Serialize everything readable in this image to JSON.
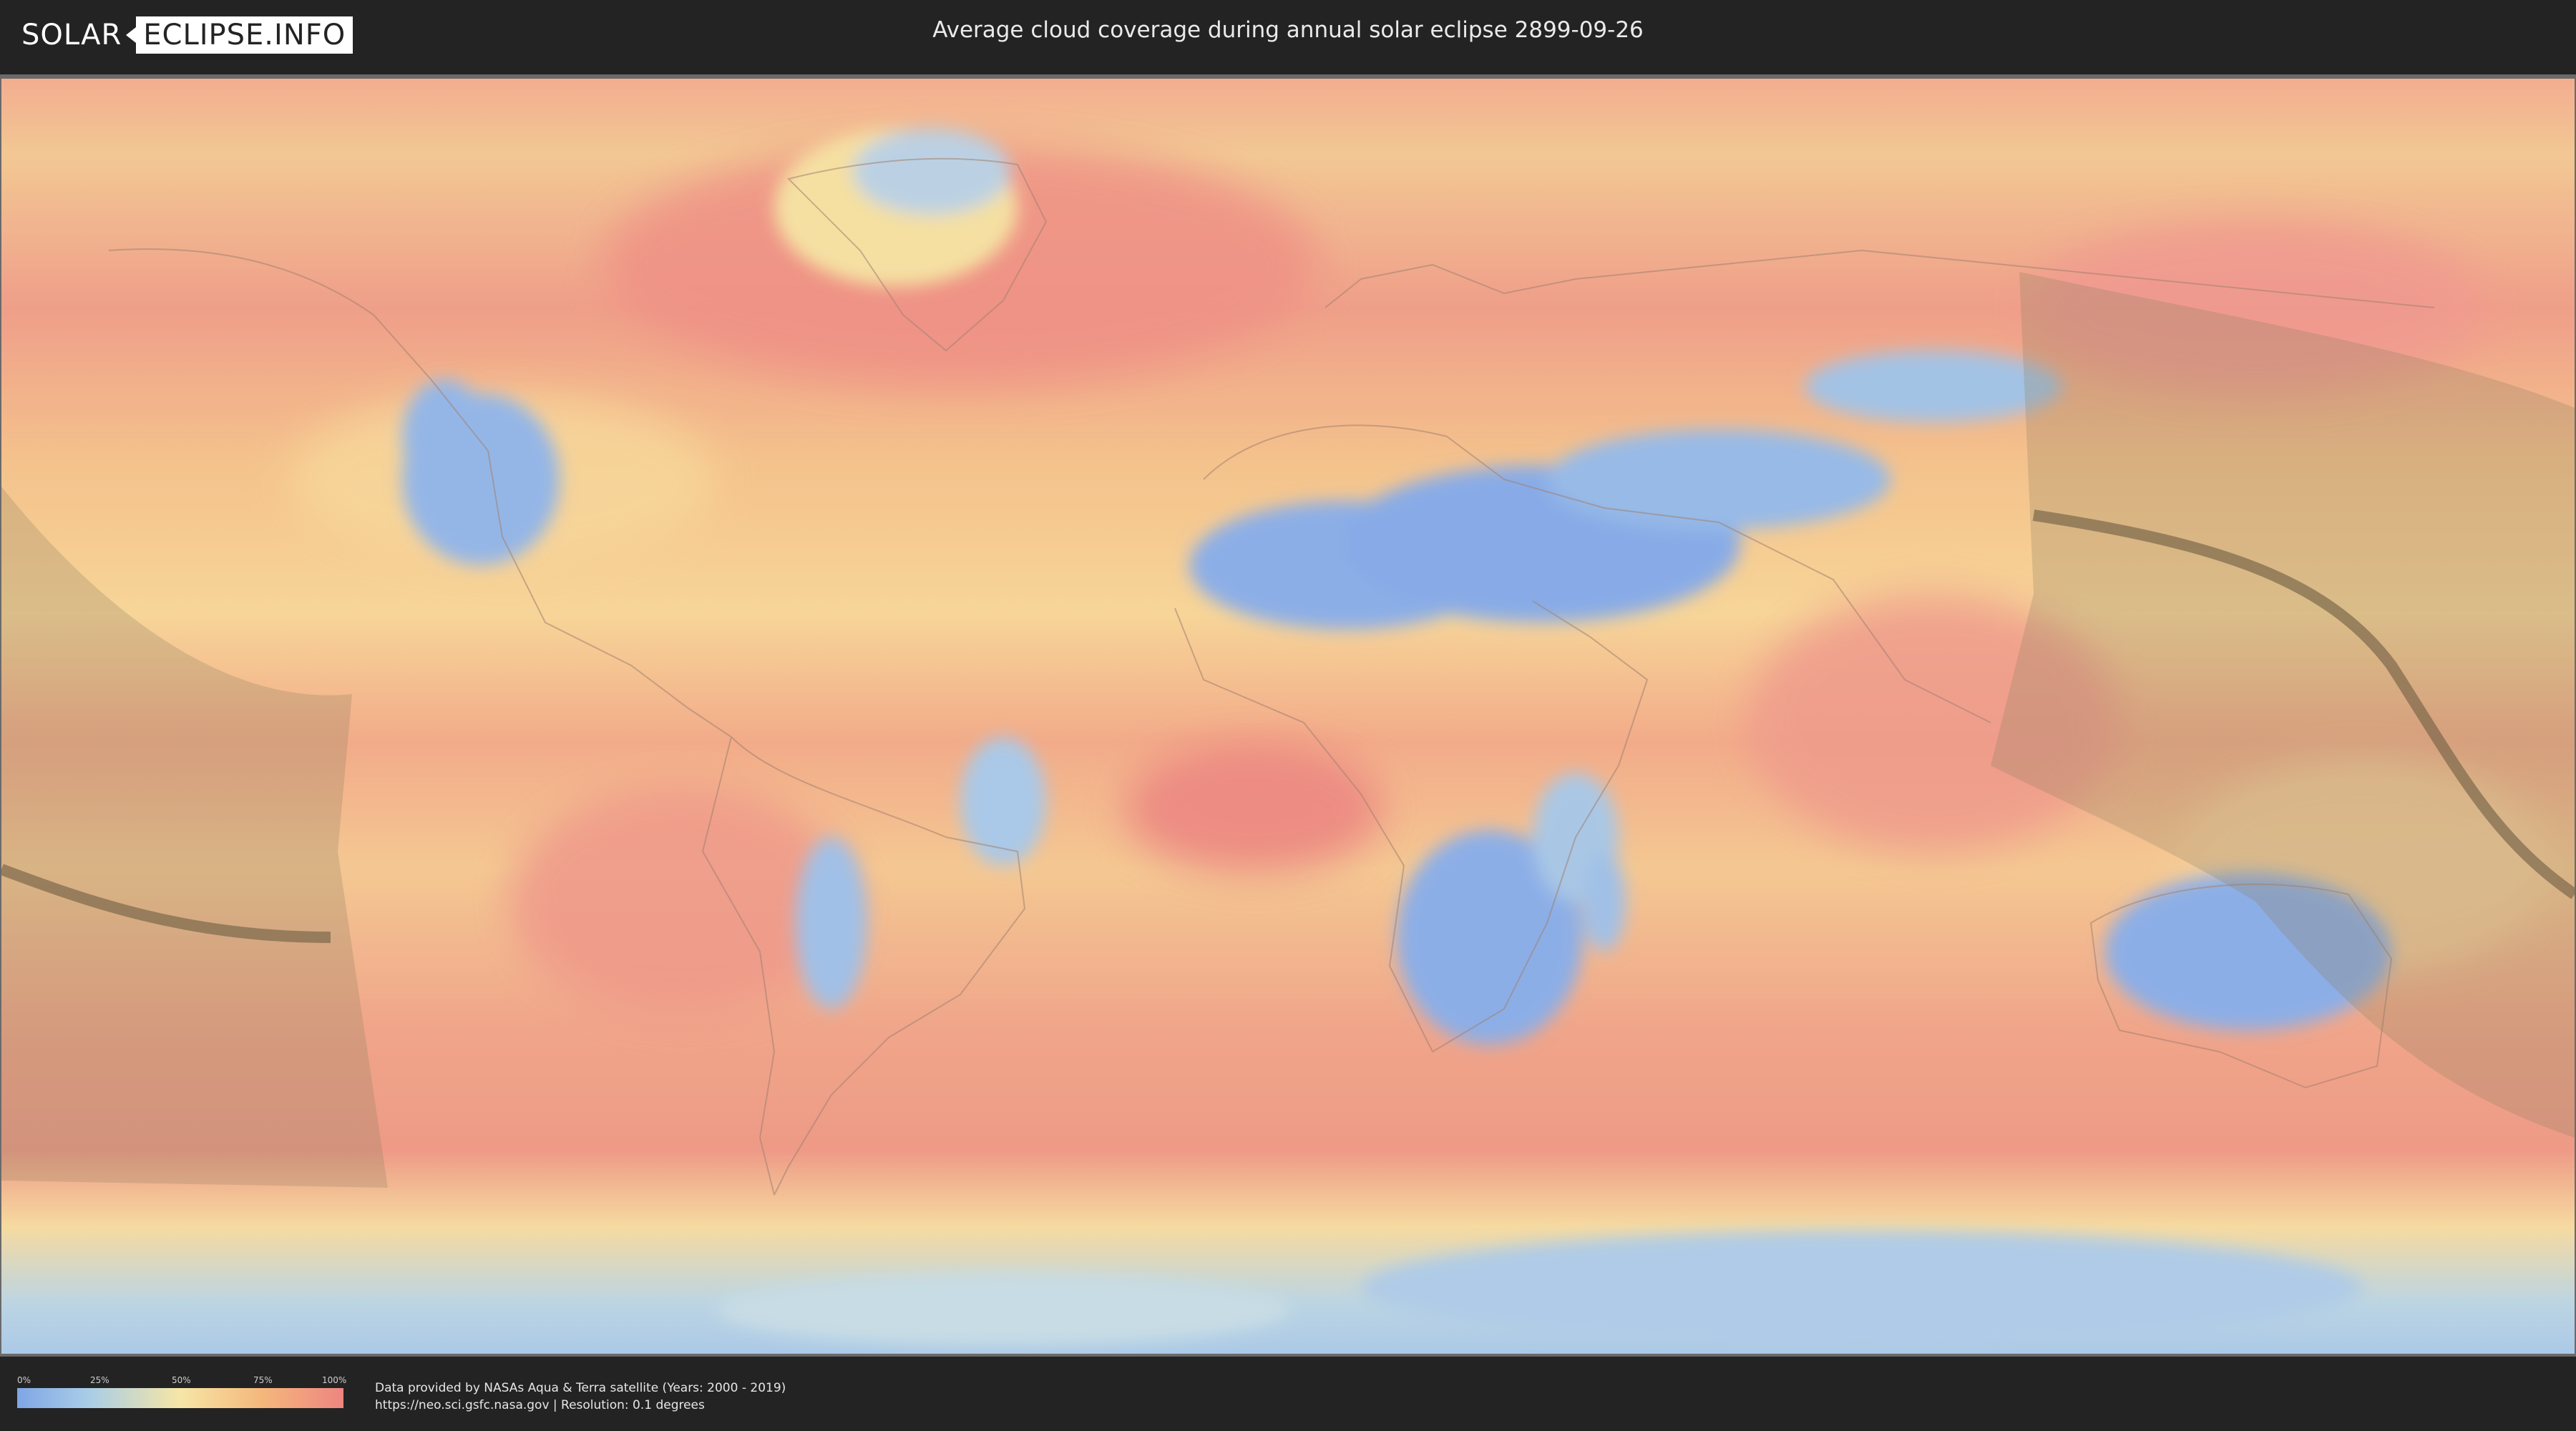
{
  "header": {
    "logo_part1": "SOLAR",
    "logo_part2": "ECLIPSE.INFO",
    "title": "Average cloud coverage during annual solar eclipse 2899-09-26"
  },
  "map": {
    "kind": "world cloud coverage map (equirectangular)",
    "features": [
      "cloud-coverage-raster",
      "country-borders",
      "eclipse-zone-shading",
      "eclipse-central-path"
    ]
  },
  "legend": {
    "ticks": [
      "0%",
      "25%",
      "50%",
      "75%",
      "100%"
    ],
    "colors": [
      "#7fa6e6",
      "#a9cde6",
      "#f6e6a6",
      "#f5b77c",
      "#ee8581"
    ]
  },
  "source": {
    "line1": "Data provided by NASAs Aqua & Terra satellite (Years: 2000 - 2019)",
    "line2": "https://neo.sci.gsfc.nasa.gov | Resolution: 0.1 degrees"
  }
}
